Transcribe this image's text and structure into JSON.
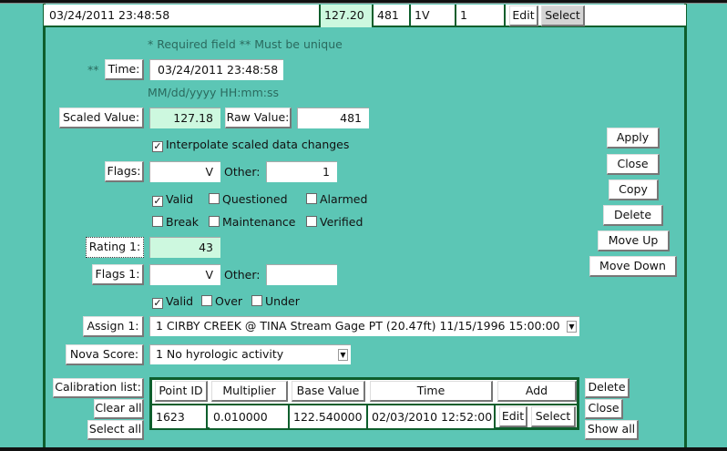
{
  "top_row": {
    "time": "03/24/2011 23:48:58",
    "scaled": "127.20",
    "raw": "481",
    "flags": "1V",
    "other": "1",
    "edit": "Edit",
    "select": "Select"
  },
  "form": {
    "required_note": "* Required field   ** Must be unique",
    "unique_marker": "**",
    "time_label": "Time:",
    "time_value": "03/24/2011 23:48:58",
    "time_format": "MM/dd/yyyy HH:mm:ss",
    "scaled_label": "Scaled Value:",
    "scaled_value": "127.18",
    "raw_label": "Raw Value:",
    "raw_value": "481",
    "interpolate_label": "Interpolate scaled data changes",
    "interpolate_checked": true,
    "flags_label": "Flags:",
    "flags_value": "V",
    "other_label": "Other:",
    "other_value": "1",
    "flag_checks": [
      {
        "label": "Valid",
        "checked": true
      },
      {
        "label": "Questioned",
        "checked": false
      },
      {
        "label": "Alarmed",
        "checked": false
      },
      {
        "label": "Break",
        "checked": false
      },
      {
        "label": "Maintenance",
        "checked": false
      },
      {
        "label": "Verified",
        "checked": false
      }
    ],
    "rating_label": "Rating 1:",
    "rating_value": "43",
    "flags1_label": "Flags 1:",
    "flags1_value": "V",
    "other1_label": "Other:",
    "other1_value": "",
    "flag1_checks": [
      {
        "label": "Valid",
        "checked": true
      },
      {
        "label": "Over",
        "checked": false
      },
      {
        "label": "Under",
        "checked": false
      }
    ],
    "assign_label": "Assign 1:",
    "assign_value": "1 CIRBY CREEK @ TINA Stream Gage PT (20.47ft) 11/15/1996 15:00:00",
    "nova_label": "Nova Score:",
    "nova_value": "1 No hyrologic activity"
  },
  "actions": [
    "Apply",
    "Close",
    "Copy",
    "Delete",
    "Move Up",
    "Move Down"
  ],
  "calibration": {
    "list_label": "Calibration list:",
    "clear_all": "Clear all",
    "select_all": "Select all",
    "headers": [
      "Point ID",
      "Multiplier",
      "Base Value",
      "Time",
      "Add"
    ],
    "rows": [
      {
        "point_id": "1623",
        "multiplier": "0.010000",
        "base_value": "122.540000",
        "time": "02/03/2010 12:52:00",
        "edit": "Edit",
        "select": "Select"
      }
    ],
    "delete": "Delete",
    "close": "Close",
    "show_all": "Show all"
  }
}
